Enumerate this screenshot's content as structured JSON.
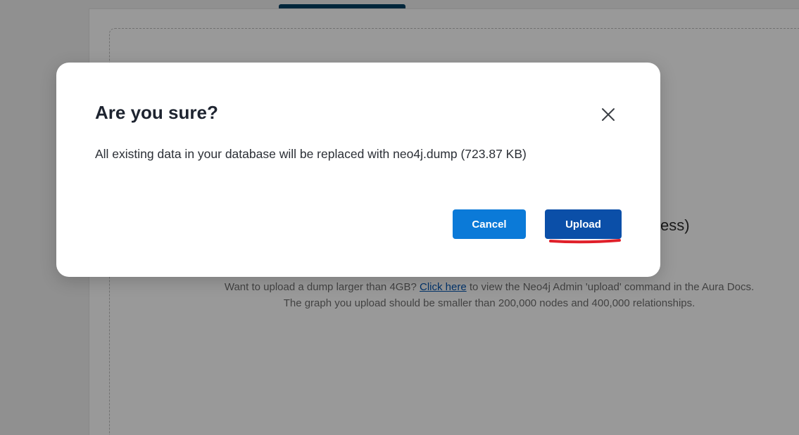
{
  "background": {
    "partial_text": "ess)",
    "info_line1_before": "Want to upload a dump larger than 4GB? ",
    "info_link": "Click here",
    "info_line1_after": " to view the Neo4j Admin 'upload' command in the Aura Docs.",
    "info_line2": "The graph you upload should be smaller than 200,000 nodes and 400,000 relationships."
  },
  "dialog": {
    "title": "Are you sure?",
    "message": "All existing data in your database will be replaced with neo4j.dump (723.87 KB)",
    "cancel_label": "Cancel",
    "upload_label": "Upload",
    "close_icon": "close-icon"
  },
  "colors": {
    "primary": "#0b4fa8",
    "secondary_button": "#0b7ad8",
    "annotation": "#e0202a"
  }
}
